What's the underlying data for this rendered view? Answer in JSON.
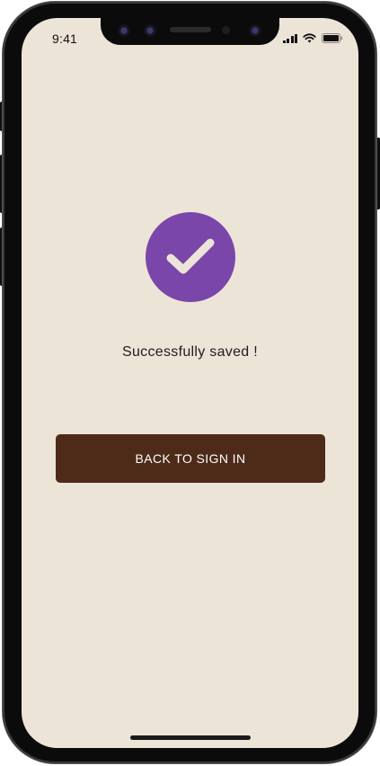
{
  "status_bar": {
    "time": "9:41",
    "icons": [
      "cellular-signal-icon",
      "wifi-icon",
      "battery-icon"
    ]
  },
  "success": {
    "icon": "checkmark-icon",
    "message": "Successfully saved !"
  },
  "actions": {
    "back_button_label": "BACK TO SIGN IN"
  },
  "theme": {
    "background": "#ede4d8",
    "accent_purple": "#7b46aa",
    "button_brown": "#4d2b18",
    "button_text": "#ffffff"
  }
}
